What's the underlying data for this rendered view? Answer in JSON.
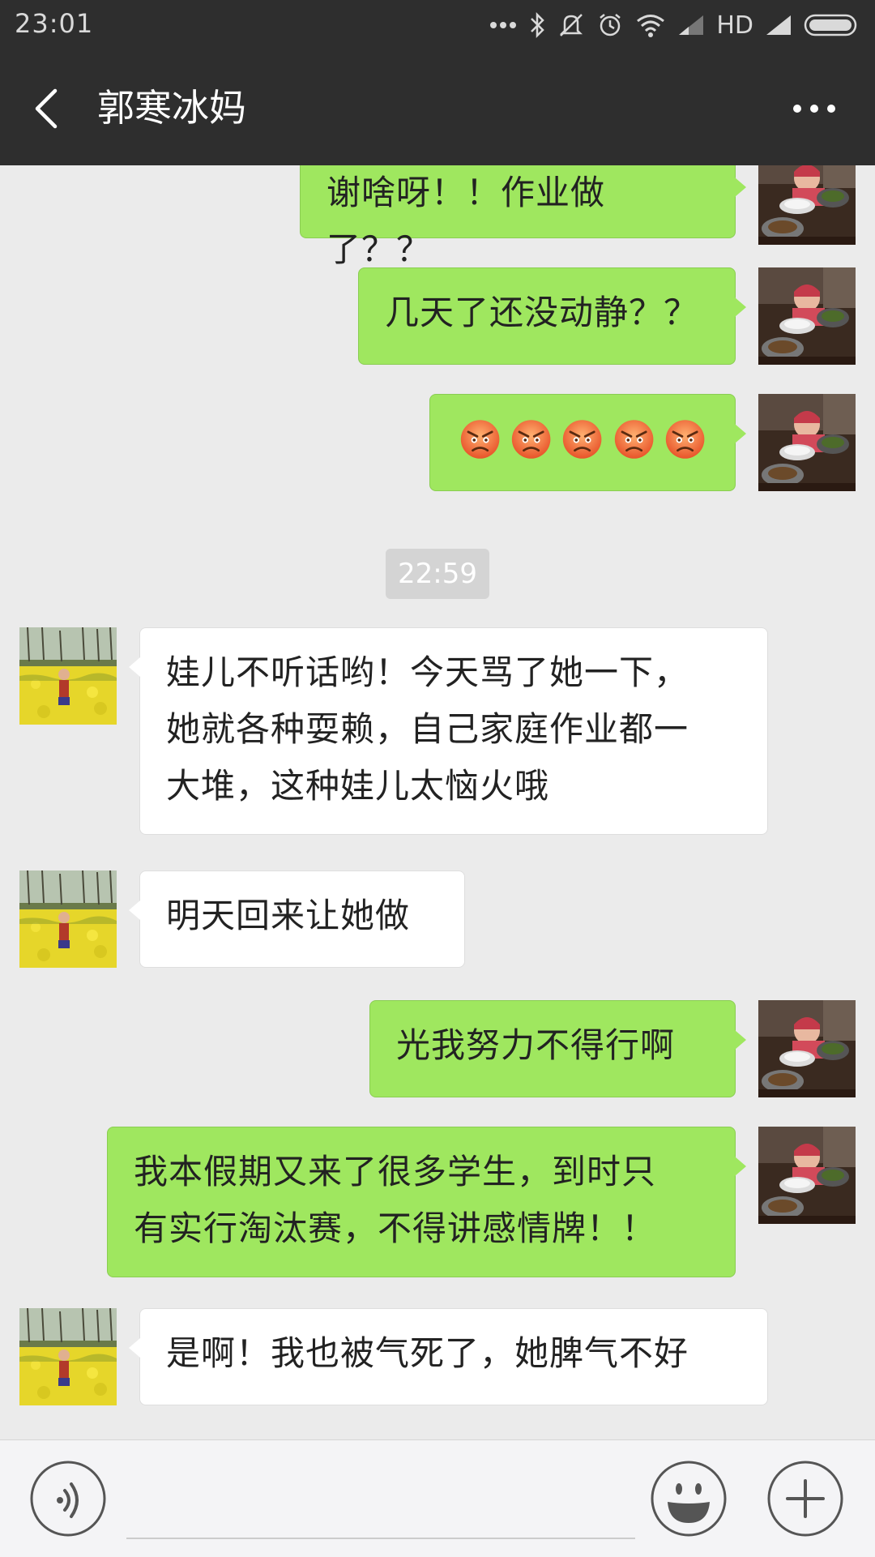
{
  "status_bar": {
    "time": "23:01",
    "network": "HD",
    "icons": [
      "dots-icon",
      "bluetooth-icon",
      "silent-icon",
      "alarm-icon",
      "wifi-icon",
      "signal-icon",
      "signal-icon",
      "battery-icon"
    ]
  },
  "header": {
    "title": "郭寒冰妈",
    "back_icon": "back-chevron-icon",
    "more_icon": "more-dots-icon"
  },
  "messages": [
    {
      "side": "out",
      "text": "谢啥呀！！作业做了？？",
      "avatar": "child-eating-photo"
    },
    {
      "side": "out",
      "text": "几天了还没动静？？",
      "avatar": "child-eating-photo"
    },
    {
      "side": "out",
      "emoji_count": 5,
      "emoji_icon": "angry-face-icon",
      "avatar": "child-eating-photo"
    },
    {
      "side": "out",
      "text": "光我努力不得行啊",
      "avatar": "child-eating-photo"
    },
    {
      "side": "out",
      "lines": [
        "我本假期又来了很多学生，到时只",
        "有实行淘汰赛，不得讲感情牌！！"
      ],
      "avatar": "child-eating-photo"
    }
  ],
  "timestamp": "22:59",
  "incoming": [
    {
      "lines": [
        "娃儿不听话哟！今天骂了她一下，",
        "她就各种耍赖，自己家庭作业都一",
        "大堆，这种娃儿太恼火哦"
      ],
      "avatar": "rapeseed-field-photo"
    },
    {
      "text": "明天回来让她做",
      "avatar": "rapeseed-field-photo"
    },
    {
      "text": "是啊！我也被气死了，她脾气不好",
      "avatar": "rapeseed-field-photo"
    }
  ],
  "input_bar": {
    "voice_icon": "voice-icon",
    "emoji_icon": "emoji-icon",
    "plus_icon": "plus-icon",
    "input_value": "",
    "input_placeholder": ""
  },
  "colors": {
    "outgoing_bubble": "#9fe75f",
    "incoming_bubble": "#ffffff",
    "header_bg": "#2e2e2e",
    "chat_bg": "#ebebeb"
  }
}
